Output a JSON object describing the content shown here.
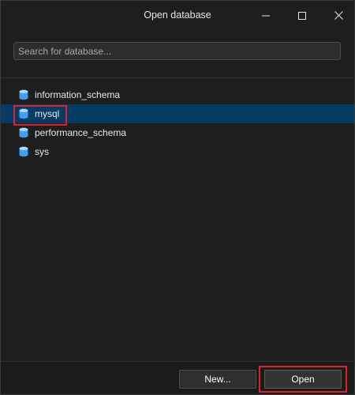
{
  "window": {
    "title": "Open database"
  },
  "search": {
    "placeholder": "Search for database..."
  },
  "databases": [
    {
      "name": "information_schema",
      "icon": "database-icon",
      "selected": false
    },
    {
      "name": "mysql",
      "icon": "database-icon",
      "selected": true
    },
    {
      "name": "performance_schema",
      "icon": "database-icon",
      "selected": false
    },
    {
      "name": "sys",
      "icon": "database-icon",
      "selected": false
    }
  ],
  "footer": {
    "new_label": "New...",
    "open_label": "Open"
  },
  "colors": {
    "background": "#1e1e1e",
    "selection": "#043c63",
    "highlight": "#e0202a",
    "icon": "#3f9ff5"
  }
}
